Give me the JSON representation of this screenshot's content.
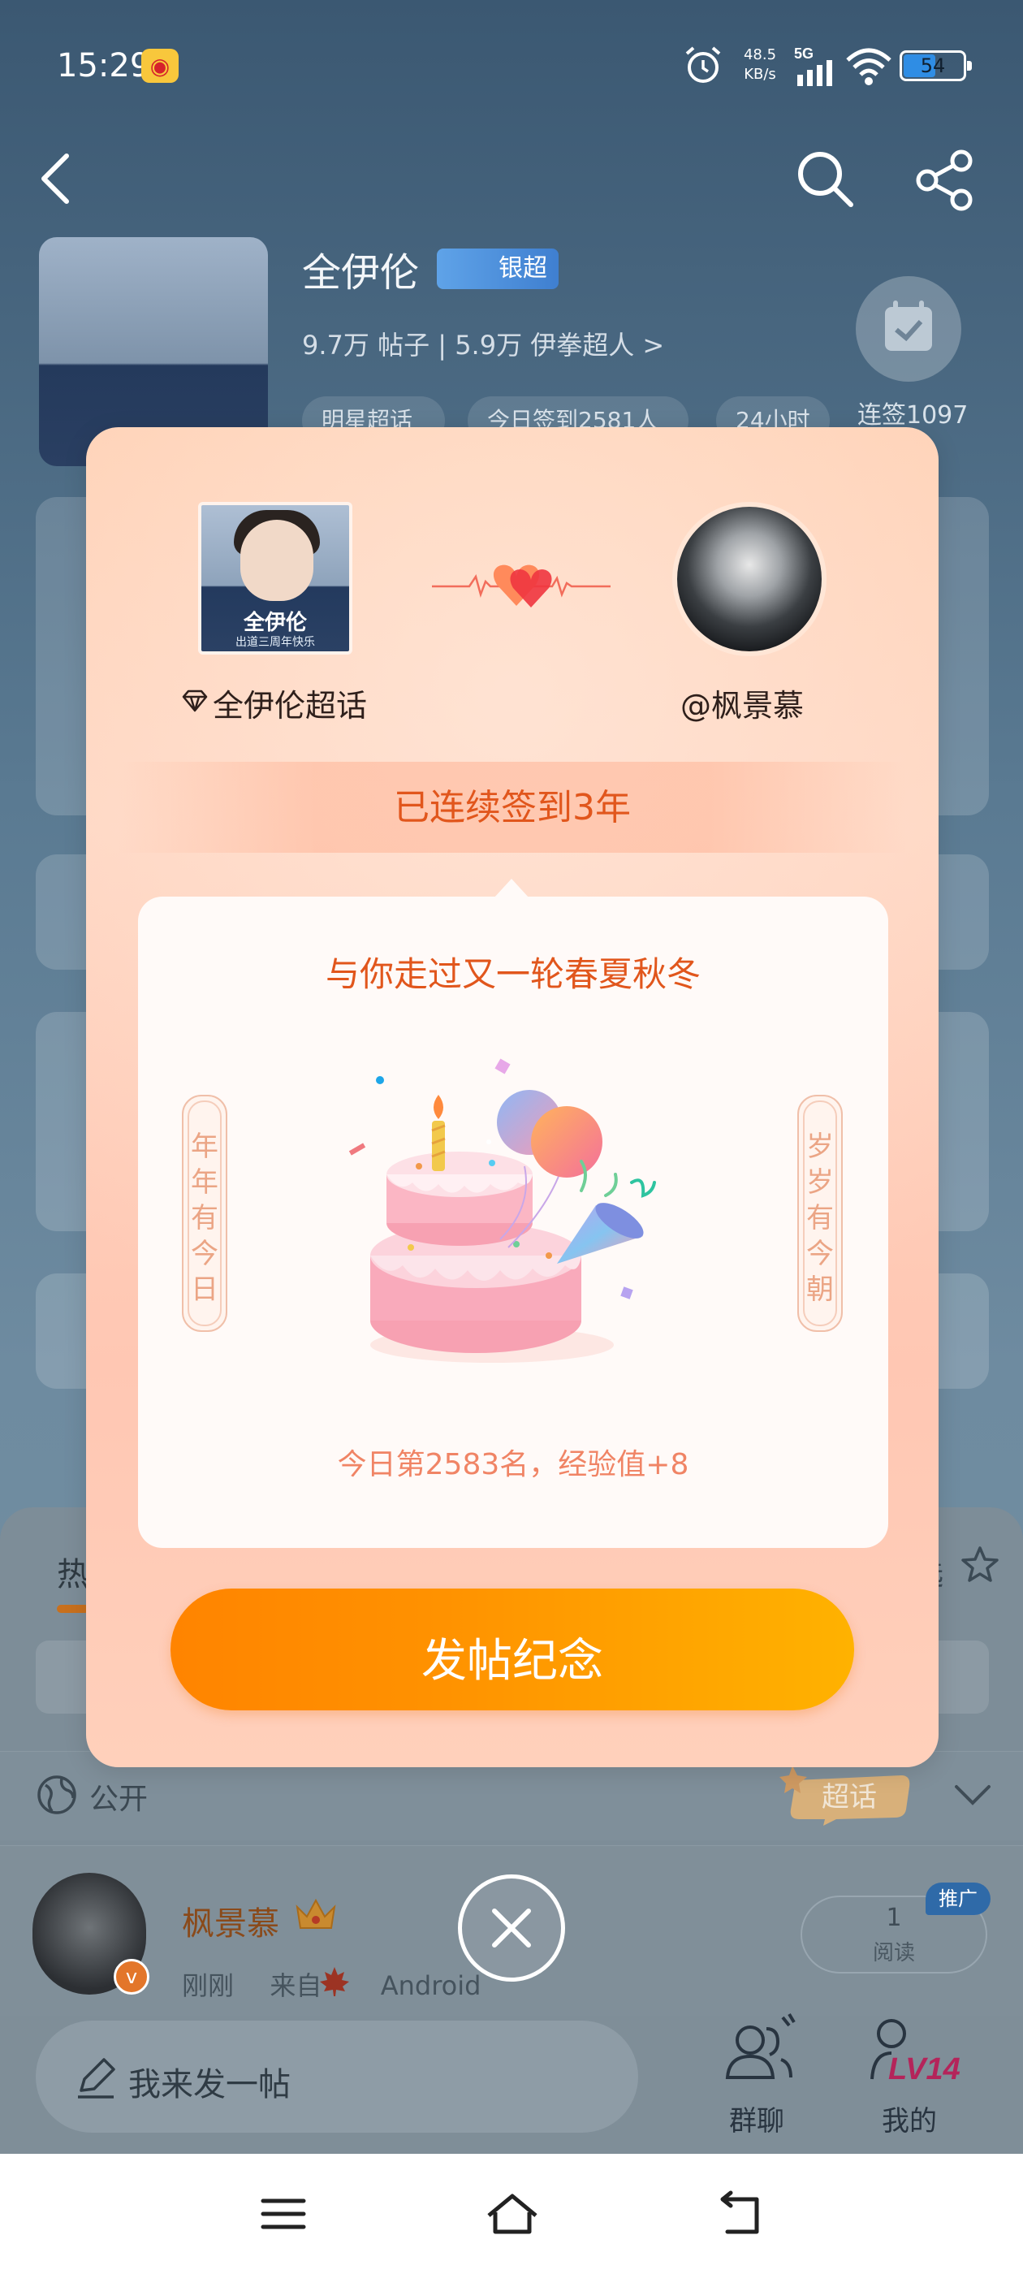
{
  "status_bar": {
    "time": "15:29",
    "net_speed_value": "48.5",
    "net_speed_unit": "KB/s",
    "network": "5G",
    "battery_level": 54,
    "battery_text": "54"
  },
  "background": {
    "topic_title": "全伊伦",
    "badge": "银超",
    "stats": "9.7万 帖子 | 5.9万 伊拳超人 >",
    "tags": [
      "明星超话",
      "今日签到2581人",
      "24小时"
    ],
    "checkin_label": "连签1097",
    "tab_hot": "热",
    "filter_label": "选",
    "visibility_label": "公开",
    "supertopic_sticker": "超话",
    "post": {
      "author": "枫景慕",
      "time": "刚刚",
      "source_prefix": "来自",
      "source": "Android",
      "read_count": "1",
      "read_label": "阅读",
      "promo_badge": "推广"
    },
    "compose_placeholder": "我来发一帖",
    "group_chat_label": "群聊",
    "me_label": "我的",
    "level_badge": "LV14"
  },
  "modal": {
    "topic_name": "全伊伦超话",
    "topic_avatar_text": "全伊伦",
    "topic_avatar_sub": "出道三周年快乐",
    "user_handle": "@枫景慕",
    "streak_text": "已连续签到3年",
    "headline": "与你走过又一轮春夏秋冬",
    "left_scroll": "年年有今日",
    "right_scroll": "岁岁有今朝",
    "rank_text": "今日第2583名，经验值+8",
    "button_label": "发帖纪念"
  },
  "colors": {
    "accent_orange": "#e1561c",
    "button_start": "#ff8400",
    "button_end": "#ffb200",
    "modal_bg": "#ffd0bb"
  }
}
